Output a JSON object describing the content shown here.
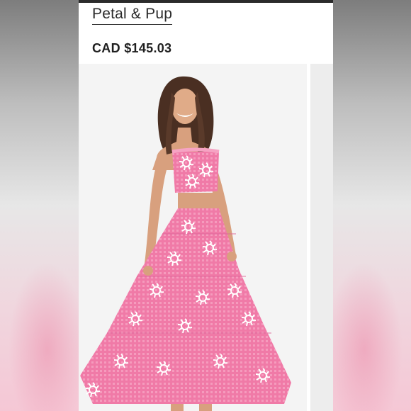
{
  "listing": {
    "brand": "Petal & Pup",
    "price": "CAD $145.03"
  },
  "colors": {
    "dress_pink": "#f07aa7",
    "dress_pink_light": "#f6a3c3",
    "print_white": "#ffffff",
    "skin": "#d8a07e",
    "hair": "#4a2f22"
  },
  "icons": {
    "sun-print": "white swirl sun motif"
  }
}
